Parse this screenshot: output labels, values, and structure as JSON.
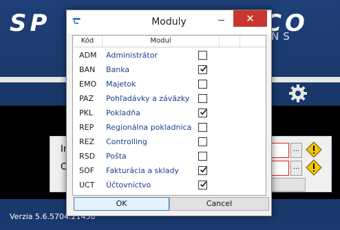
{
  "background_app": {
    "logo_left": "SP",
    "logo_right": "CO",
    "logo_subtitle": "NS",
    "label_1": "In",
    "label_2": "C",
    "browse_1": "...",
    "browse_2": "...",
    "version": "Verzia 5.6.5704.21450"
  },
  "dialog": {
    "title": "Moduly",
    "close_glyph": "✕",
    "columns": {
      "code": "Kód",
      "module": "Modul"
    },
    "rows": [
      {
        "code": "ADM",
        "name": "Administrátor",
        "checked": false
      },
      {
        "code": "BAN",
        "name": "Banka",
        "checked": true
      },
      {
        "code": "EMO",
        "name": "Majetok",
        "checked": false
      },
      {
        "code": "PAZ",
        "name": "Pohľadávky a záväzky",
        "checked": false
      },
      {
        "code": "PKL",
        "name": "Pokladňa",
        "checked": true
      },
      {
        "code": "REP",
        "name": "Regionálna pokladnica",
        "checked": false
      },
      {
        "code": "REZ",
        "name": "Controlling",
        "checked": false
      },
      {
        "code": "RSD",
        "name": "Pošta",
        "checked": false
      },
      {
        "code": "SOF",
        "name": "Fakturácia a sklady",
        "checked": true
      },
      {
        "code": "UCT",
        "name": "Účtovníctvo",
        "checked": true
      }
    ],
    "ok_label": "OK",
    "cancel_label": "Cancel"
  },
  "colors": {
    "app_background": "#1b3a6b",
    "close_button": "#c7372f",
    "module_text": "#1c3f8f",
    "warning": "#f5c400",
    "error_border": "#e0201b"
  },
  "icons": {
    "titlebar": "app-icon",
    "settings": "gear-icon",
    "warning": "warning-icon",
    "check": "checkmark-icon"
  }
}
